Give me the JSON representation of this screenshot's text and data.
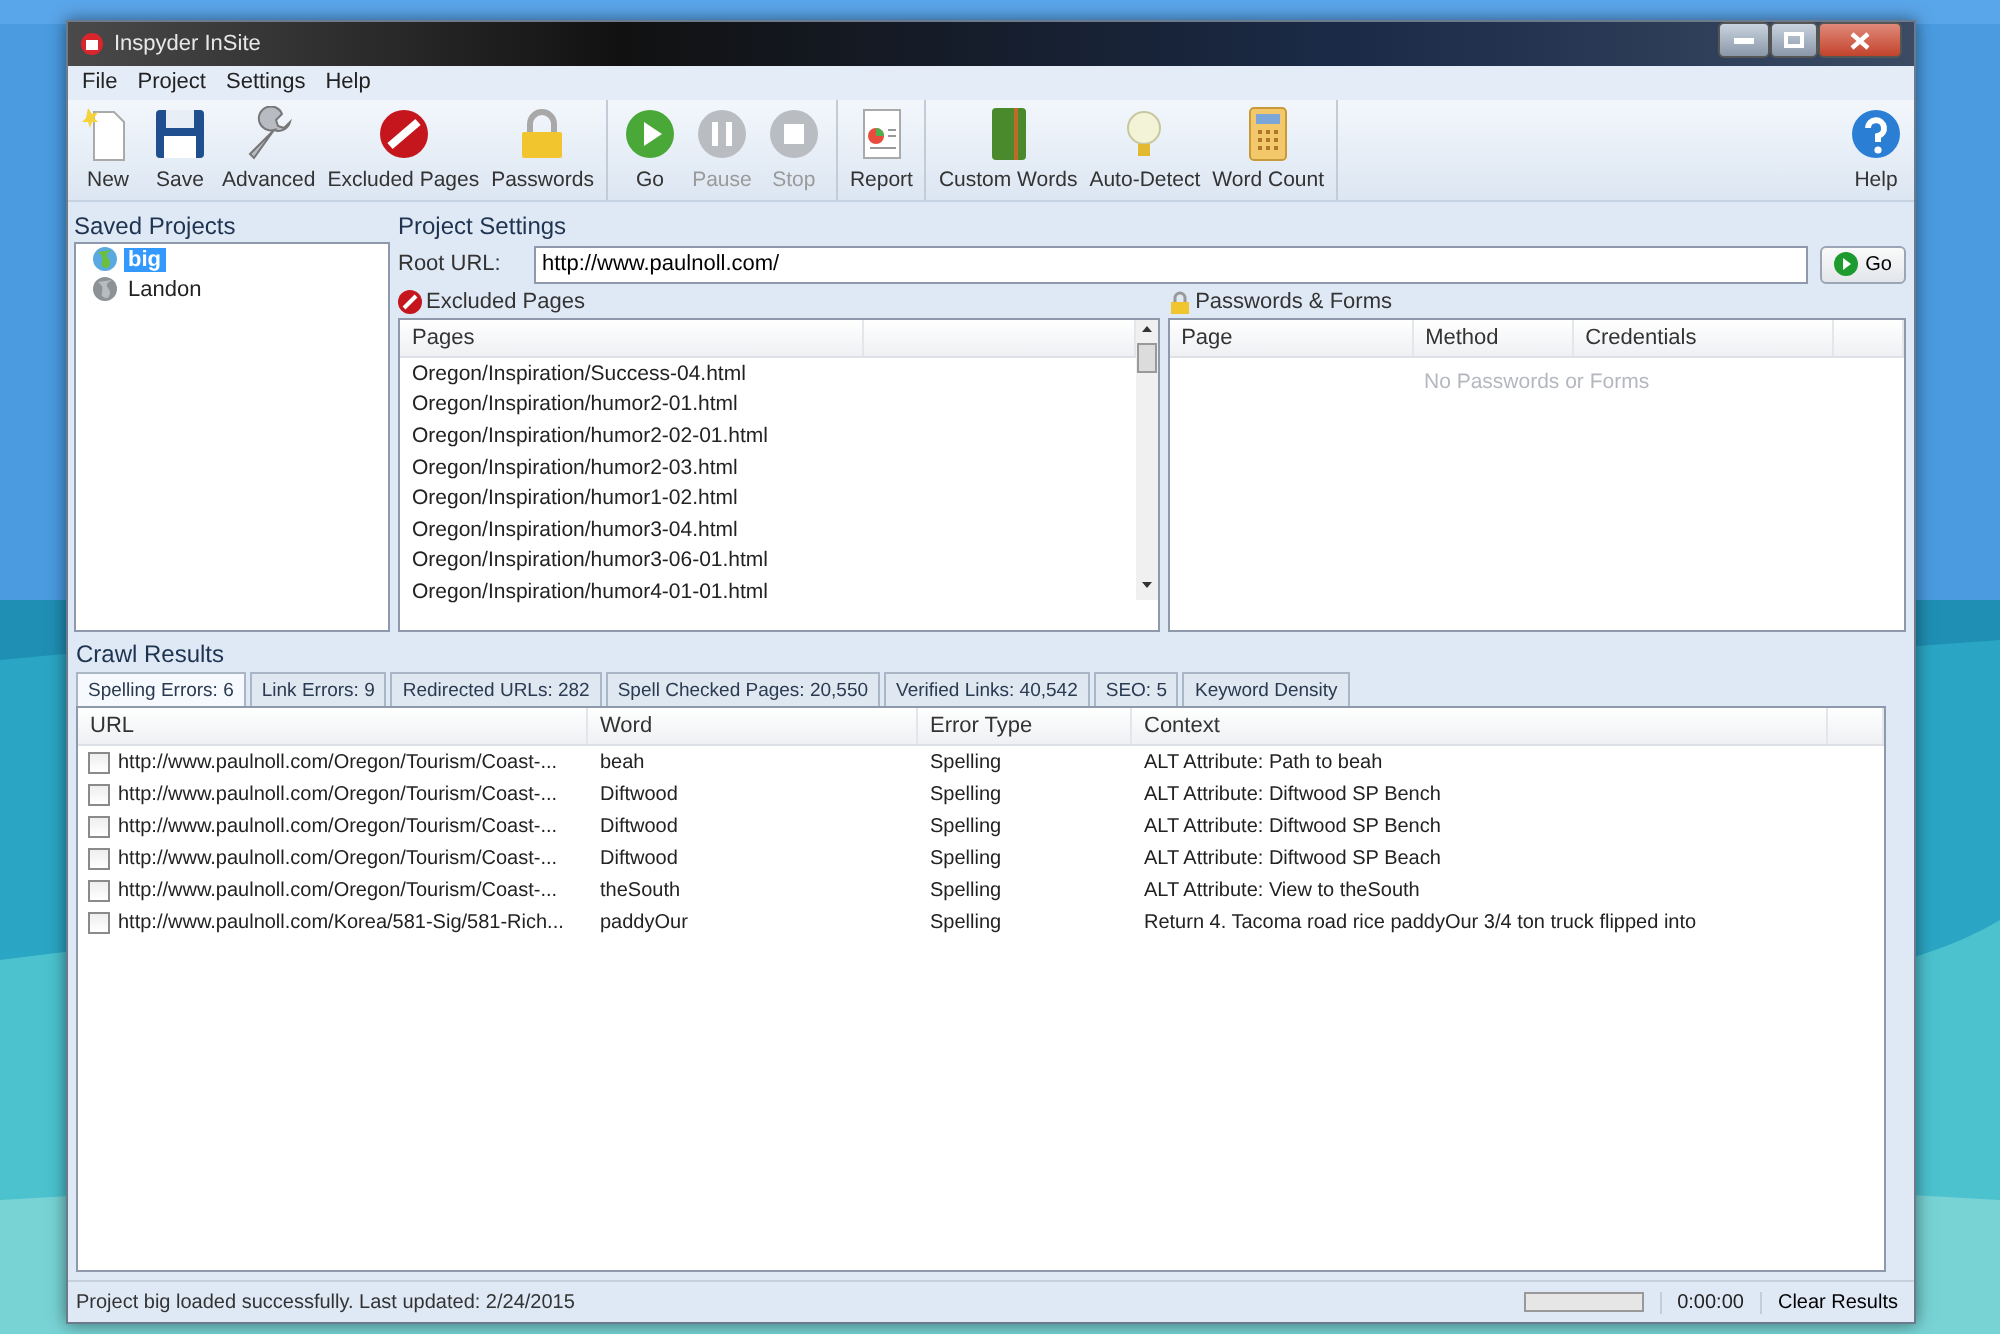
{
  "window": {
    "title": "Inspyder InSite"
  },
  "menu": [
    "File",
    "Project",
    "Settings",
    "Help"
  ],
  "toolbar_groups": [
    {
      "items": [
        {
          "label": "New",
          "kind": "new",
          "disabled": false
        },
        {
          "label": "Save",
          "kind": "save",
          "disabled": false
        },
        {
          "label": "Advanced",
          "kind": "advanced",
          "disabled": false
        },
        {
          "label": "Excluded Pages",
          "kind": "excluded",
          "disabled": false
        },
        {
          "label": "Passwords",
          "kind": "passwords",
          "disabled": false
        }
      ]
    },
    {
      "items": [
        {
          "label": "Go",
          "kind": "go",
          "disabled": false
        },
        {
          "label": "Pause",
          "kind": "pause",
          "disabled": true
        },
        {
          "label": "Stop",
          "kind": "stop",
          "disabled": true
        }
      ]
    },
    {
      "items": [
        {
          "label": "Report",
          "kind": "report",
          "disabled": false
        }
      ]
    },
    {
      "items": [
        {
          "label": "Custom Words",
          "kind": "words",
          "disabled": false
        },
        {
          "label": "Auto-Detect",
          "kind": "bulb",
          "disabled": false
        },
        {
          "label": "Word Count",
          "kind": "calculator",
          "disabled": false
        }
      ]
    }
  ],
  "help_button": {
    "label": "Help"
  },
  "saved_projects": {
    "title": "Saved Projects",
    "items": [
      {
        "label": "big",
        "selected": true
      },
      {
        "label": "Landon",
        "selected": false
      }
    ]
  },
  "project_settings": {
    "title": "Project Settings",
    "root_url_label": "Root URL:",
    "root_url": "http://www.paulnoll.com/",
    "go_button": "Go",
    "excluded_pages": {
      "title": "Excluded Pages",
      "column": "Pages",
      "rows": [
        "Oregon/Inspiration/Success-04.html",
        "Oregon/Inspiration/humor2-01.html",
        "Oregon/Inspiration/humor2-02-01.html",
        "Oregon/Inspiration/humor2-03.html",
        "Oregon/Inspiration/humor1-02.html",
        "Oregon/Inspiration/humor3-04.html",
        "Oregon/Inspiration/humor3-06-01.html",
        "Oregon/Inspiration/humor4-01-01.html"
      ]
    },
    "passwords_forms": {
      "title": "Passwords & Forms",
      "columns": [
        "Page",
        "Method",
        "Credentials"
      ],
      "empty_text": "No Passwords or Forms"
    }
  },
  "crawl_results": {
    "title": "Crawl Results",
    "tabs": [
      {
        "label": "Spelling Errors: 6",
        "selected": true
      },
      {
        "label": "Link Errors: 9",
        "selected": false
      },
      {
        "label": "Redirected URLs: 282",
        "selected": false
      },
      {
        "label": "Spell Checked Pages: 20,550",
        "selected": false
      },
      {
        "label": "Verified Links: 40,542",
        "selected": false
      },
      {
        "label": "SEO: 5",
        "selected": false
      },
      {
        "label": "Keyword Density",
        "selected": false
      }
    ],
    "columns": [
      "URL",
      "Word",
      "Error Type",
      "Context"
    ],
    "rows": [
      {
        "checked": false,
        "url": "http://www.paulnoll.com/Oregon/Tourism/Coast-...",
        "word": "beah",
        "error_type": "Spelling",
        "context": "ALT Attribute: Path to beah"
      },
      {
        "checked": false,
        "url": "http://www.paulnoll.com/Oregon/Tourism/Coast-...",
        "word": "Diftwood",
        "error_type": "Spelling",
        "context": "ALT Attribute: Diftwood SP Bench"
      },
      {
        "checked": false,
        "url": "http://www.paulnoll.com/Oregon/Tourism/Coast-...",
        "word": "Diftwood",
        "error_type": "Spelling",
        "context": "ALT Attribute: Diftwood SP Bench"
      },
      {
        "checked": false,
        "url": "http://www.paulnoll.com/Oregon/Tourism/Coast-...",
        "word": "Diftwood",
        "error_type": "Spelling",
        "context": "ALT Attribute: Diftwood SP Beach"
      },
      {
        "checked": false,
        "url": "http://www.paulnoll.com/Oregon/Tourism/Coast-...",
        "word": "theSouth",
        "error_type": "Spelling",
        "context": "ALT Attribute: View to theSouth"
      },
      {
        "checked": false,
        "url": "http://www.paulnoll.com/Korea/581-Sig/581-Rich...",
        "word": "paddyOur",
        "error_type": "Spelling",
        "context": "Return 4. Tacoma road rice paddyOur 3/4 ton truck flipped into"
      }
    ]
  },
  "status_bar": {
    "message": "Project big loaded successfully. Last updated: 2/24/2015",
    "progress": {
      "level": 0
    },
    "elapsed": "0:00:00",
    "clear_button": "Clear Results"
  }
}
